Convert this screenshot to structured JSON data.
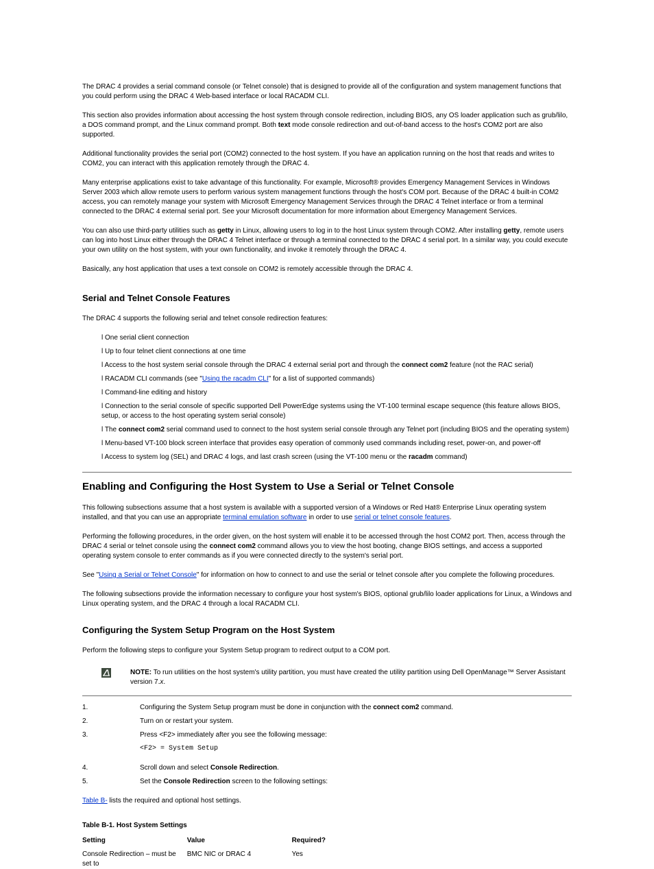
{
  "intro": {
    "p1": "The DRAC 4 provides a serial command console (or Telnet console) that is designed to provide all of the configuration and system management functions that you could perform using the DRAC 4 Web-based interface or local RACADM CLI.",
    "p2_a": "This section also provides information about accessing the host system through console redirection, including BIOS, any OS loader application such as grub/lilo, a DOS command prompt, and the Linux command prompt. Both ",
    "p2_b_bold": "text",
    "p2_c": " mode console redirection and out-of-band access to the host's COM2 port are also supported.",
    "p3": "Additional functionality provides the serial port (COM2) connected to the host system. If you have an application running on the host that reads and writes to COM2, you can interact with this application remotely through the DRAC 4.",
    "p4_a": "Many enterprise applications exist to take advantage of this functionality. For example, Microsoft",
    "p4_reg": "®",
    "p4_b": " provides Emergency Management Services in Windows Server 2003 which allow remote users to perform various system management functions through the host's COM port. Because of the DRAC 4 built-in COM2 access, you can remotely manage your system with Microsoft Emergency Management Services through the DRAC 4 Telnet interface or from a terminal connected to the DRAC 4 external serial port. See your Microsoft documentation for more information about Emergency Management Services.",
    "p5_a": "You can also use third-party utilities such as ",
    "p5_bold1": "getty",
    "p5_b": " in Linux, allowing users to log in to the host Linux system through COM2. After installing ",
    "p5_bold2": "getty",
    "p5_c": ", remote users can log into host Linux either through the DRAC 4 Telnet interface or through a terminal connected to the DRAC 4 serial port. In a similar way, you could execute your own utility on the host system, with your own functionality, and invoke it remotely through the DRAC 4.",
    "p6": "Basically, any host application that uses a text console on COM2 is remotely accessible through the DRAC 4."
  },
  "features_title": "Serial and Telnet Console Features",
  "features": {
    "lead": "The DRAC 4 supports the following serial and telnet console redirection features:",
    "b1": "One serial client connection",
    "b2": "Up to four telnet client connections at one time",
    "b3_a": "Access to the host system serial console through the DRAC 4 external serial port and through the ",
    "b3_bold": "connect com2",
    "b3_b": " feature (not the RAC serial)",
    "b4_a": "RACADM CLI commands (see \"",
    "b4_link": "Using the racadm CLI",
    "b4_b": "\" for a list of supported commands)",
    "b5": "Command-line editing and history",
    "b6": "Connection to the serial console of specific supported Dell PowerEdge systems using the VT-100 terminal escape sequence (this feature allows BIOS, setup, or access to the host operating system serial console)",
    "b7_a": "The ",
    "b7_bold": "connect com2",
    "b7_b": " serial command used to connect to the host system serial console through any Telnet port (including BIOS and the operating system)",
    "b8": "Menu-based VT-100 block screen interface that provides easy operation of commonly used commands including reset, power-on, and power-off",
    "b9_a": "Access to system log (SEL) and DRAC 4 logs, and last crash screen (using the VT-100 menu or the ",
    "b9_bold": "racadm",
    "b9_b": " command)"
  },
  "enable_title": "Enabling and Configuring the Host System to Use a Serial or Telnet Console",
  "enable": {
    "p1_a": "This following subsections assume that a host system is available with a supported version of a Windows or Red Hat",
    "p1_reg": "®",
    "p1_b": " Enterprise Linux operating system installed, and that you can use an appropriate ",
    "p1_link1": "terminal emulation software",
    "p1_c": " in order to use ",
    "p1_link2": "serial or telnet console features",
    "p1_d": ".",
    "p2_a": "Performing the following procedures, in the order given, on the host system will enable it to be accessed through the host COM2 port. Then, access through the DRAC 4 serial or telnet console using the ",
    "p2_bold": "connect com2",
    "p2_b": " command allows you to view the host booting, change BIOS settings, and access a supported operating system console to enter commands as if you were connected directly to the system's serial port.",
    "p3_a": "See \"",
    "p3_link": "Using a Serial or Telnet Console",
    "p3_b": "\" for information on how to connect to and use the serial or telnet console after you complete the following procedures.",
    "p4": "The following subsections provide the information necessary to configure your host system's BIOS, optional grub/lilo loader applications for Linux, a Windows and Linux operating system, and the DRAC 4 through a local RACADM CLI."
  },
  "bios_title": "Configuring the System Setup Program on the Host System",
  "bios": {
    "p1": "Perform the following steps to configure your System Setup program to redirect output to a COM port."
  },
  "note": {
    "label": "NOTE:",
    "text_a": " To run utilities on the host system's utility partition, you must have created the utility partition using Dell OpenManage™ Server Assistant version 7.",
    "text_b": "x",
    "text_c": "."
  },
  "steps": {
    "s1_lead": "Configuring the System Setup program must be done in conjunction with the ",
    "s1_bold": "connect com2",
    "s1_tail": " command.",
    "s2": "Turn on or restart your system.",
    "s3_a": "Press <F2> immediately after you see the following message:",
    "s3_code": "<F2> = System Setup",
    "s4_a": "Scroll down and select ",
    "s4_bold": "Console Redirection",
    "s4_end": ".",
    "s5_a": "Set the ",
    "s5_bold": "Console Redirection",
    "s5_b": " screen to the following settings:"
  },
  "settings_link": "Table B-",
  "settings_tail": " lists the required and optional host settings.",
  "table": {
    "caption": "Table B-1. Host System Settings",
    "h1": "Setting",
    "h2": "Value",
    "h3": "Required?",
    "r1c1": "Console Redirection – must be set to",
    "r1c2": "BMC NIC or DRAC 4",
    "r1c3": "Yes"
  }
}
